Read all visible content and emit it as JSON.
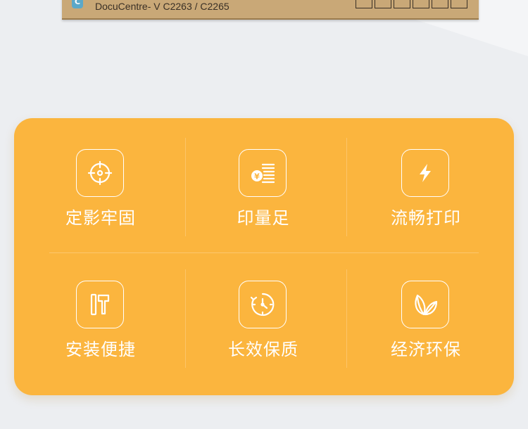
{
  "product_box": {
    "logo_letter": "C",
    "model_text": "DocuCentre- V C2263 / C2265"
  },
  "features": [
    {
      "label": "定影牢固",
      "icon": "crosshair-target-icon"
    },
    {
      "label": "印量足",
      "icon": "coin-stack-icon"
    },
    {
      "label": "流畅打印",
      "icon": "lightning-bolt-icon"
    },
    {
      "label": "安装便捷",
      "icon": "hammer-tool-icon"
    },
    {
      "label": "长效保质",
      "icon": "clock-timer-icon"
    },
    {
      "label": "经济环保",
      "icon": "leaf-icon"
    }
  ],
  "colors": {
    "card": "#fbb53e",
    "background": "#eceef1",
    "foreground": "#ffffff"
  }
}
